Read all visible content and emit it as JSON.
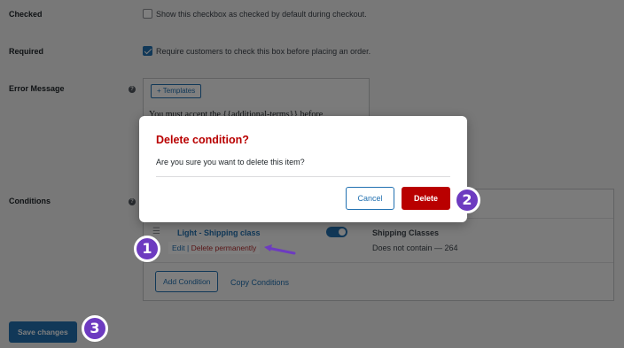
{
  "settings": {
    "checked": {
      "label": "Checked",
      "description": "Show this checkbox as checked by default during checkout."
    },
    "required": {
      "label": "Required",
      "description": "Require customers to check this box before placing an order."
    },
    "error_message": {
      "label": "Error Message",
      "templates_button": "+ Templates",
      "value": "You must accept the {{additional-terms}} before"
    },
    "conditions": {
      "label": "Conditions",
      "item": {
        "title": "Light - Shipping class",
        "actions": {
          "edit": "Edit",
          "separator": " | ",
          "delete": "Delete permanently"
        },
        "type": "Shipping Classes",
        "rule": "Does not contain — 264"
      },
      "add_button": "Add Condition",
      "copy_link": "Copy Conditions"
    },
    "help_icon": "?",
    "save_button": "Save changes"
  },
  "modal": {
    "title": "Delete condition?",
    "body": "Are you sure you want to delete this item?",
    "cancel": "Cancel",
    "delete": "Delete"
  },
  "steps": [
    "1",
    "2",
    "3"
  ],
  "colors": {
    "accent": "#2271b1",
    "danger": "#b90000",
    "marker": "#6d3bc0"
  }
}
